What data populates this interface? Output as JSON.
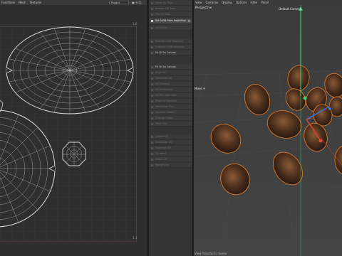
{
  "uv_editor": {
    "menu": [
      "Functions",
      "Mesh",
      "Textures"
    ],
    "projection_value": "Project",
    "toolbar_icons": "▣ ⟲ ◫",
    "corner_tr": "1,0",
    "corner_br": "1,1"
  },
  "commands": [
    "Relax UV Tags",
    "Realign UV Tags",
    "Flip UV Tags",
    "Set UVW from Projection",
    "UV Shells",
    "Rebuild UVW Mapping",
    "Collapse UVW Mapping",
    "Fit UV to Canvas",
    "Fit UV to Canvas",
    "Align UV",
    "Distribute UV",
    "UV Cleanup",
    "UV Straighten",
    "UV Pin Unpinned",
    "Edge UV Relaxed",
    "Normalize UVs",
    "Equalize Shells",
    "Unwrap Shells",
    "Pack UVs",
    "Layout UV",
    "Subdivide UV",
    "Optimize UV",
    "UV Weld",
    "Stitch UV",
    "Merge UVs"
  ],
  "viewport": {
    "menu": [
      "View",
      "Cameras",
      "Display",
      "Options",
      "Filter",
      "Panel"
    ],
    "view_name": "Perspective",
    "camera_name": "Default Camera",
    "tool_label": "Move ✛",
    "status": "View Transform: Scene"
  },
  "colors": {
    "potato_outline": "#d97a2a",
    "axis_x": "#e0453a",
    "axis_y": "#3fd07a",
    "axis_z": "#3a78e0"
  }
}
